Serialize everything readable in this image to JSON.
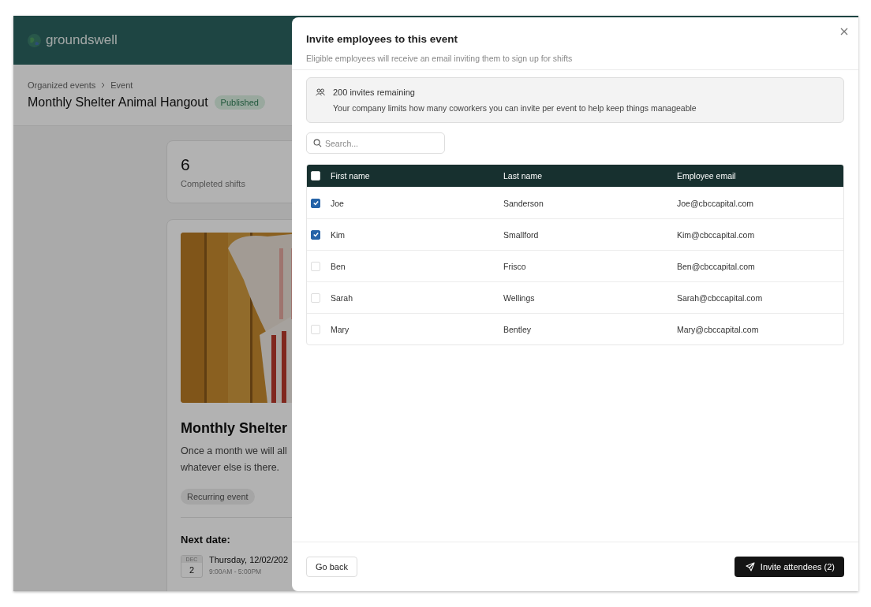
{
  "app": {
    "brand": "groundswell"
  },
  "breadcrumb": [
    "Organized events",
    "Event"
  ],
  "event": {
    "title": "Monthly Shelter Animal Hangout",
    "status": "Published"
  },
  "stat": {
    "value": "6",
    "label": "Completed shifts"
  },
  "event_card": {
    "image": {
      "kind": "picture"
    },
    "title": "Monthly Shelter",
    "description": [
      "Once a month we will all",
      "whatever else is there."
    ],
    "tag": "Recurring event",
    "next_date_label": "Next date:",
    "date": {
      "month": "DEC",
      "day": "2",
      "weekday_date": "Thursday, 12/02/202",
      "time": "9:00AM - 5:00PM"
    }
  },
  "modal": {
    "title": "Invite employees to this event",
    "subtitle": "Eligible employees will receive an email inviting them to sign up for shifts",
    "notice": {
      "title": "200 invites remaining",
      "text": "Your company limits how many coworkers you can invite per event to help keep things manageable"
    },
    "search": {
      "placeholder": "Search..."
    },
    "table": {
      "select_all_checked": false,
      "columns": [
        "First name",
        "Last name",
        "Employee email"
      ],
      "rows": [
        {
          "checked": true,
          "first": "Joe",
          "last": "Sanderson",
          "email": "Joe@cbccapital.com"
        },
        {
          "checked": true,
          "first": "Kim",
          "last": "Smallford",
          "email": "Kim@cbccapital.com"
        },
        {
          "checked": false,
          "first": "Ben",
          "last": "Frisco",
          "email": "Ben@cbccapital.com"
        },
        {
          "checked": false,
          "first": "Sarah",
          "last": "Wellings",
          "email": "Sarah@cbccapital.com"
        },
        {
          "checked": false,
          "first": "Mary",
          "last": "Bentley",
          "email": "Mary@cbccapital.com"
        }
      ]
    },
    "buttons": {
      "back": "Go back",
      "invite": "Invite attendees (2)"
    }
  }
}
